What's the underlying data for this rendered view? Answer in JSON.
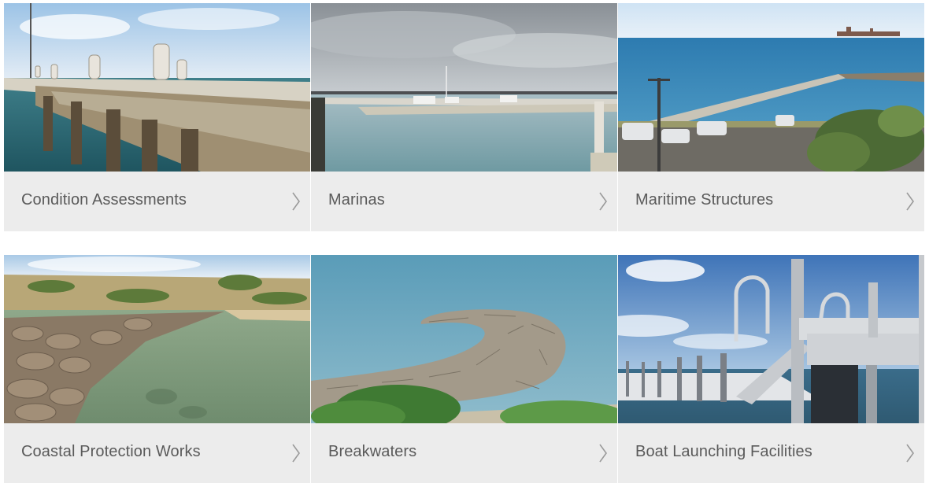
{
  "tiles": [
    {
      "label": "Condition Assessments",
      "icon": "chevron-right-icon"
    },
    {
      "label": "Marinas",
      "icon": "chevron-right-icon"
    },
    {
      "label": "Maritime Structures",
      "icon": "chevron-right-icon"
    },
    {
      "label": "Coastal Protection Works",
      "icon": "chevron-right-icon"
    },
    {
      "label": "Breakwaters",
      "icon": "chevron-right-icon"
    },
    {
      "label": "Boat Launching Facilities",
      "icon": "chevron-right-icon"
    }
  ],
  "colors": {
    "caption_bg": "#ececec",
    "caption_text": "#5a5a5a",
    "chevron": "#9a9a9a"
  }
}
